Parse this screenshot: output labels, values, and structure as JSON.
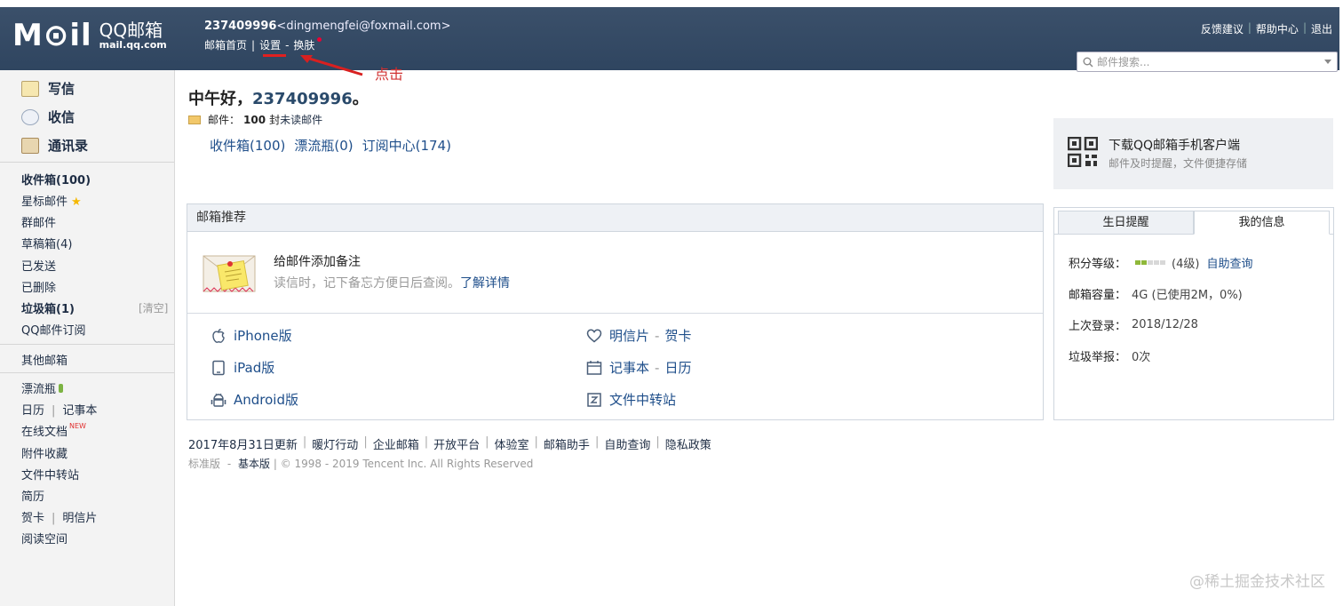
{
  "header": {
    "logo_main": "M⊙il",
    "logo_qq": "QQ邮箱",
    "logo_url": "mail.qq.com",
    "account_id": "237409996",
    "account_email": "<dingmengfei@foxmail.com>",
    "nav_home": "邮箱首页",
    "nav_settings": "设置",
    "nav_dash": "-",
    "nav_skin": "换肤",
    "top_links": [
      "反馈建议",
      "帮助中心",
      "退出"
    ],
    "search_placeholder": "邮件搜索...",
    "annotation": "点击"
  },
  "sidebar": {
    "actions": [
      {
        "label": "写信",
        "icon": "pencil-icon"
      },
      {
        "label": "收信",
        "icon": "inbox-icon"
      },
      {
        "label": "通讯录",
        "icon": "contacts-icon"
      }
    ],
    "folders": [
      {
        "label": "收件箱(100)",
        "bold": true
      },
      {
        "label": "星标邮件",
        "star": true
      },
      {
        "label": "群邮件"
      },
      {
        "label": "草稿箱(4)"
      },
      {
        "label": "已发送"
      },
      {
        "label": "已删除"
      },
      {
        "label": "垃圾箱(1)",
        "bold": true
      },
      {
        "label": "QQ邮件订阅"
      }
    ],
    "clear_label": "[清空]",
    "other_mailbox": "其他邮箱",
    "tools": {
      "bottle": "漂流瓶",
      "calendar": "日历",
      "notes": "记事本",
      "online_docs": "在线文档",
      "new_tag": "NEW",
      "attachments": "附件收藏",
      "transfer": "文件中转站",
      "resume": "简历",
      "greeting_card": "贺卡",
      "postcard": "明信片",
      "reading": "阅读空间"
    }
  },
  "main": {
    "greeting_prefix": "中午好，",
    "greeting_uid": "237409996",
    "greeting_suffix": "。",
    "mail_label": "邮件：",
    "mail_count": "100",
    "mail_unit": "封",
    "unread_label": "未读邮件",
    "quick_links": [
      "收件箱(100)",
      "漂流瓶(0)",
      "订阅中心(174)"
    ],
    "promo": {
      "title": "下载QQ邮箱手机客户端",
      "subtitle": "邮件及时提醒，文件便捷存储"
    },
    "recommend": {
      "heading": "邮箱推荐",
      "feature_title": "给邮件添加备注",
      "feature_desc": "读信时，记下备忘方便日后查阅。",
      "feature_more": "了解详情",
      "left_links": [
        {
          "label": "iPhone版",
          "icon": "apple-icon"
        },
        {
          "label": "iPad版",
          "icon": "ipad-icon"
        },
        {
          "label": "Android版",
          "icon": "android-icon"
        }
      ],
      "right_links": [
        {
          "label": "明信片",
          "extra": "贺卡",
          "icon": "heart-icon"
        },
        {
          "label": "记事本",
          "extra": "日历",
          "icon": "calendar-icon"
        },
        {
          "label": "文件中转站",
          "extra": "",
          "icon": "file-transfer-icon"
        }
      ]
    },
    "info": {
      "tab_birthday": "生日提醒",
      "tab_myinfo": "我的信息",
      "level_label": "积分等级：",
      "level_value": "(4级)",
      "level_filled": 2,
      "level_total": 5,
      "self_query": "自助查询",
      "capacity_label": "邮箱容量：",
      "capacity_value": "4G (已使用2M，0%)",
      "last_login_label": "上次登录：",
      "last_login_value": "2018/12/28",
      "spam_label": "垃圾举报：",
      "spam_value": "0次"
    },
    "footer_links": [
      "2017年8月31日更新",
      "暖灯行动",
      "企业邮箱",
      "开放平台",
      "体验室",
      "邮箱助手",
      "自助查询",
      "隐私政策"
    ],
    "copyright_standard": "标准版",
    "copyright_basic": "基本版",
    "copyright_text": "| © 1998 - 2019 Tencent Inc. All Rights Reserved"
  },
  "watermark": "@稀土掘金技术社区"
}
